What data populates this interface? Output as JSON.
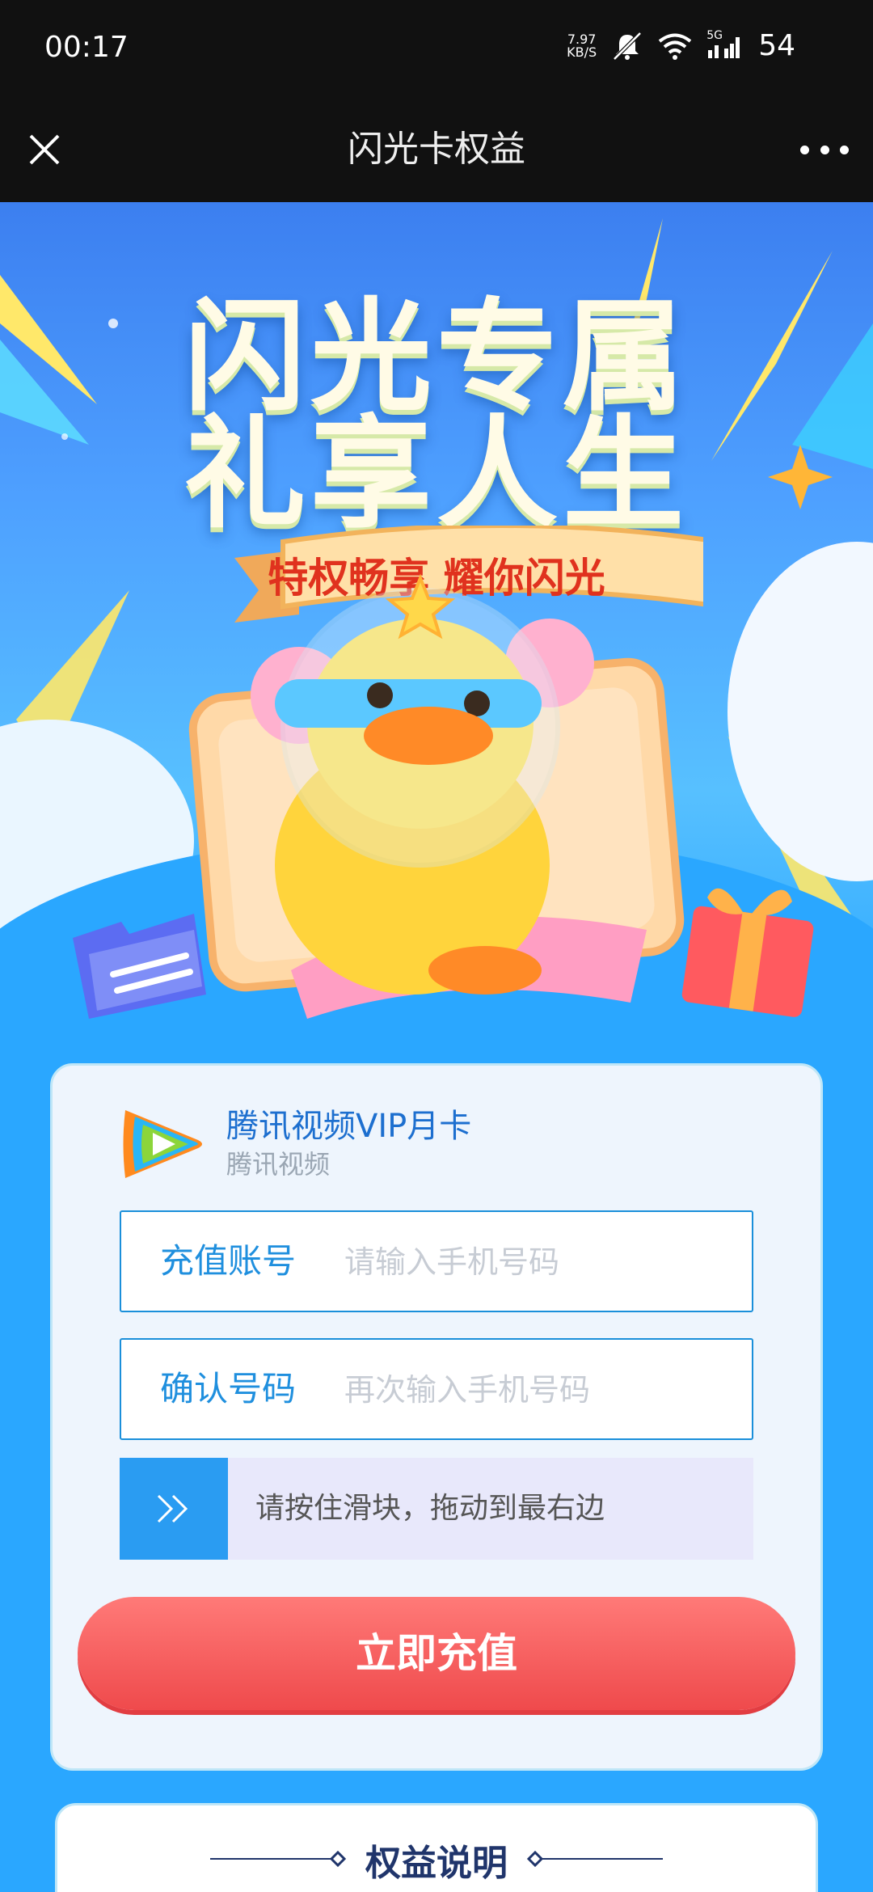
{
  "status": {
    "time": "00:17",
    "net_speed_value": "7.97",
    "net_speed_unit": "KB/S",
    "signal_label": "5G",
    "battery": "54"
  },
  "nav": {
    "title": "闪光卡权益"
  },
  "hero": {
    "title_line1": "闪光专属",
    "title_line2": "礼享人生",
    "ribbon_text": "特权畅享 耀你闪光"
  },
  "product": {
    "name": "腾讯视频VIP月卡",
    "provider": "腾讯视频"
  },
  "form": {
    "account_label": "充值账号",
    "account_placeholder": "请输入手机号码",
    "confirm_label": "确认号码",
    "confirm_placeholder": "再次输入手机号码",
    "slider_text": "请按住滑块，拖动到最右边",
    "submit_label": "立即充值"
  },
  "benefits": {
    "title": "权益说明"
  }
}
